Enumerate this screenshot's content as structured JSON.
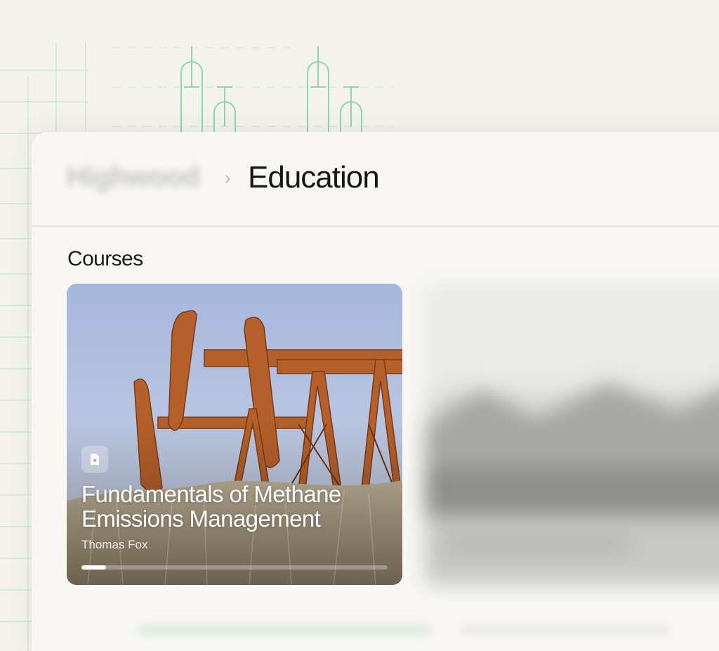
{
  "breadcrumb": {
    "brand": "Highwood",
    "current": "Education"
  },
  "section": {
    "title": "Courses"
  },
  "courses": [
    {
      "title": "Fundamentals of Methane Emissions Management",
      "author": "Thomas Fox",
      "icon": "document-icon",
      "progress": 0.08
    }
  ],
  "colors": {
    "accent_green": "#7fd3a8",
    "pumpjack_orange": "#b8652a",
    "background": "#f3f2ed"
  }
}
